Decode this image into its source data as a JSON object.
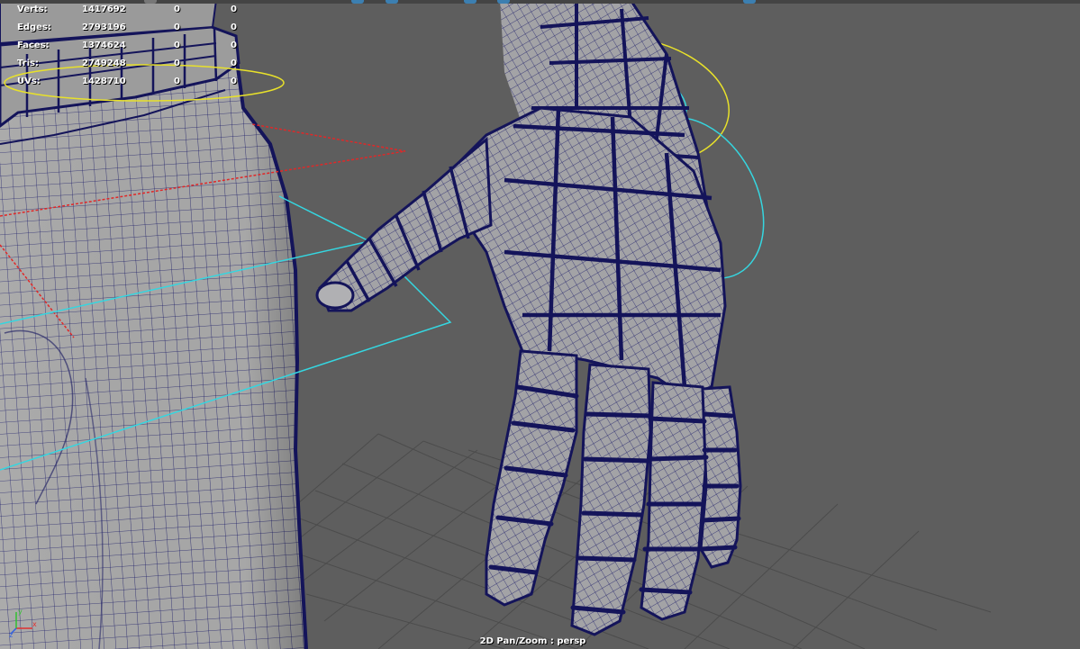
{
  "hud": {
    "rows": [
      {
        "label": "Verts:",
        "total": "1417692",
        "sel1": "0",
        "sel2": "0"
      },
      {
        "label": "Edges:",
        "total": "2793196",
        "sel1": "0",
        "sel2": "0"
      },
      {
        "label": "Faces:",
        "total": "1374624",
        "sel1": "0",
        "sel2": "0"
      },
      {
        "label": "Tris:",
        "total": "2749248",
        "sel1": "0",
        "sel2": "0"
      },
      {
        "label": "UVs:",
        "total": "1428710",
        "sel1": "0",
        "sel2": "0"
      }
    ]
  },
  "viewport": {
    "status": "2D Pan/Zoom : persp",
    "camera": "persp",
    "background_color": "#5e5e5e",
    "mesh_color": "#a9a9a9",
    "wire_color": "#1a1a6e",
    "grid_color": "#4a4a4a"
  },
  "controls": {
    "ik_yellow": "#e8e12a",
    "ik_cyan": "#35d6e0",
    "ik_red": "#e02828"
  },
  "axis_gizmo": {
    "x_label": "x",
    "y_label": "y",
    "z_label": "z"
  }
}
